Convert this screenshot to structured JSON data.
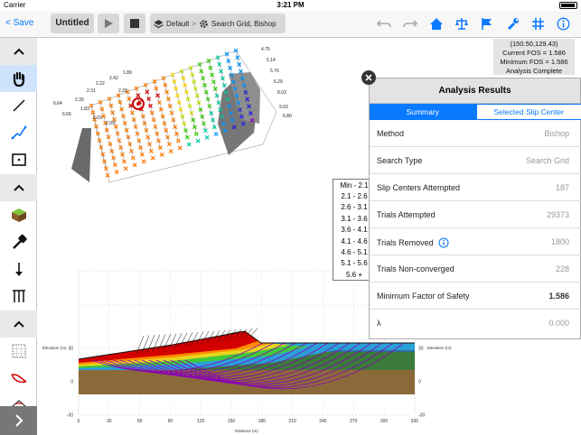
{
  "status_bar": {
    "carrier": "Carrier",
    "time": "3:21 PM"
  },
  "toolbar": {
    "save_label": "Save",
    "document_title": "Untitled",
    "breadcrumb_scenario": "Default",
    "breadcrumb_analysis": "Search Grid, Bishop"
  },
  "fos_summary": {
    "coordinates": "(150.50,129.43)",
    "current_fos": "Current FOS = 1.586",
    "minimum_fos": "Minimum FOS = 1.586",
    "status": "Analysis Complete"
  },
  "legend": {
    "entries": [
      {
        "label": "Min - 2.1",
        "color": "#d40000"
      },
      {
        "label": "2.1 - 2.6",
        "color": "#ff7a00"
      },
      {
        "label": "2.6 - 3.1",
        "color": "#ffd800"
      },
      {
        "label": "3.1 - 3.6",
        "color": "#c8e600"
      },
      {
        "label": "3.6 - 4.1",
        "color": "#33cc00"
      },
      {
        "label": "4.1 - 4.6",
        "color": "#00c8a0"
      },
      {
        "label": "4.6 - 5.1",
        "color": "#0096ff"
      },
      {
        "label": "5.1 - 5.6",
        "color": "#2020e0"
      },
      {
        "label": "5.6 +",
        "color": "#8a00b8"
      }
    ]
  },
  "analysis_panel": {
    "title": "Analysis Results",
    "tabs": {
      "summary": "Summary",
      "slip_center": "Selected Slip Center"
    },
    "rows": [
      {
        "label": "Method",
        "value": "Bishop"
      },
      {
        "label": "Search Type",
        "value": "Search Grid"
      },
      {
        "label": "Slip Centers Attempted",
        "value": "187"
      },
      {
        "label": "Trials Attempted",
        "value": "29373"
      },
      {
        "label": "Trials Removed",
        "value": "1800"
      },
      {
        "label": "Trials Non-converged",
        "value": "228"
      },
      {
        "label": "Minimum Factor of Safety",
        "value": "1.586"
      },
      {
        "label": "λ",
        "value": "0.000"
      }
    ]
  },
  "section_view": {
    "y_axis_label": "Elevation (m)",
    "right_axis_label": "Elevation (m)",
    "x_axis_label": "Distance (m)",
    "y_ticks": [
      "30",
      "0",
      "-30"
    ],
    "right_y_ticks": [
      "30",
      "0",
      "-30"
    ],
    "x_ticks": [
      "0",
      "30",
      "60",
      "90",
      "120",
      "150",
      "180",
      "210",
      "240",
      "270",
      "300",
      "330"
    ]
  },
  "grid_labels": [
    "4.75",
    "5.14",
    "5.76",
    "6.29",
    "8.03",
    "9.03",
    "6.80",
    "2.35",
    "2.31",
    "2.22",
    "2.42",
    "1.89",
    "1.83",
    "2.03",
    "2.09",
    "6.64",
    "6.66",
    "2.29"
  ],
  "colors": {
    "accent": "#0a7aff",
    "toolbar_bg": "#f7f7f7",
    "sidebar_bg": "#e9e9e9",
    "panel_header": "#e3e3e3"
  }
}
